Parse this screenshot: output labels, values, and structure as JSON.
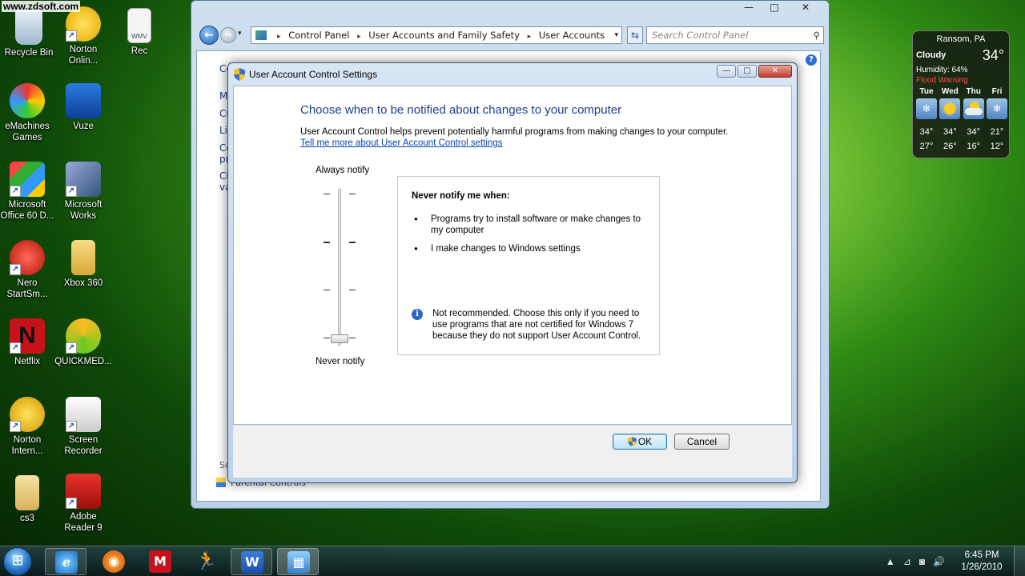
{
  "watermark": "www.zdsoft.com",
  "desktop_icons": [
    {
      "label": "Recycle Bin",
      "icon": "recycle-bin-icon"
    },
    {
      "label": "Norton Onlin...",
      "icon": "norton-online-icon"
    },
    {
      "label": "Rec",
      "icon": "wmv-file-icon",
      "badge": "WMV"
    },
    {
      "label": "eMachines Games",
      "icon": "emachines-games-icon"
    },
    {
      "label": "Vuze",
      "icon": "vuze-icon"
    },
    {
      "label": "Microsoft Office 60 D...",
      "icon": "office-trial-icon"
    },
    {
      "label": "Microsoft Works",
      "icon": "microsoft-works-icon"
    },
    {
      "label": "Nero StartSm...",
      "icon": "nero-icon"
    },
    {
      "label": "Xbox 360",
      "icon": "folder-icon"
    },
    {
      "label": "Netflix",
      "icon": "netflix-icon",
      "badge": "N"
    },
    {
      "label": "QUICKMED...",
      "icon": "quickmedia-icon"
    },
    {
      "label": "Norton Intern...",
      "icon": "norton-internet-icon"
    },
    {
      "label": "Screen Recorder",
      "icon": "screen-recorder-icon"
    },
    {
      "label": "cs3",
      "icon": "folder-icon"
    },
    {
      "label": "Adobe Reader 9",
      "icon": "adobe-reader-icon"
    }
  ],
  "control_panel": {
    "caption_buttons": {
      "minimize": "—",
      "maximize": "□",
      "close": "✕"
    },
    "nav": {
      "back": "←",
      "forward": "→",
      "dropdown": "▾"
    },
    "breadcrumb": [
      "Control Panel",
      "User Accounts and Family Safety",
      "User Accounts"
    ],
    "breadcrumb_sep": "▸",
    "search_placeholder": "Search Control Panel",
    "help": "?",
    "side_partials": [
      "Co",
      "Ma",
      "Cr",
      "Lin",
      "Co",
      "pr",
      "Ch",
      "va"
    ],
    "bottom_partials": [
      "Se",
      "Parental Controls"
    ]
  },
  "uac": {
    "title": "User Account Control Settings",
    "caption_buttons": {
      "minimize": "—",
      "maximize": "□",
      "close": "✕"
    },
    "heading": "Choose when to be notified about changes to your computer",
    "intro": "User Account Control helps prevent potentially harmful programs from making changes to your computer.",
    "learn_more": "Tell me more about User Account Control settings",
    "slider": {
      "top_label": "Always notify",
      "bottom_label": "Never notify",
      "levels": 4,
      "selected_level": 1
    },
    "description": {
      "title": "Never notify me when:",
      "bullets": [
        "Programs try to install software or make changes to my computer",
        "I make changes to Windows settings"
      ],
      "note_icon": "i",
      "note": "Not recommended. Choose this only if you need to use programs that are not certified for Windows 7 because they do not support User Account Control."
    },
    "buttons": {
      "ok": "OK",
      "cancel": "Cancel"
    }
  },
  "weather": {
    "location": "Ransom, PA",
    "condition": "Cloudy",
    "temperature": "34°",
    "humidity": "Humidity: 64%",
    "warning": "Flood Warning",
    "days": [
      "Tue",
      "Wed",
      "Thu",
      "Fri"
    ],
    "highs": [
      "34°",
      "34°",
      "34°",
      "21°"
    ],
    "lows": [
      "27°",
      "26°",
      "16°",
      "12°"
    ]
  },
  "taskbar": {
    "pinned": [
      "Internet Explorer",
      "Firefox",
      "McAfee",
      "AIM",
      "Word",
      "Control Panel"
    ],
    "pinned_glyphs": [
      "e",
      "◉",
      "M",
      "🏃",
      "W",
      "▦"
    ],
    "tray_glyphs": [
      "▲",
      "⊿",
      "◙",
      "🔊"
    ],
    "time": "6:45 PM",
    "date": "1/26/2010"
  },
  "colors": {
    "heading": "#1e3d8f",
    "link": "#0645ad",
    "flood_warning": "#ff4b4b"
  }
}
